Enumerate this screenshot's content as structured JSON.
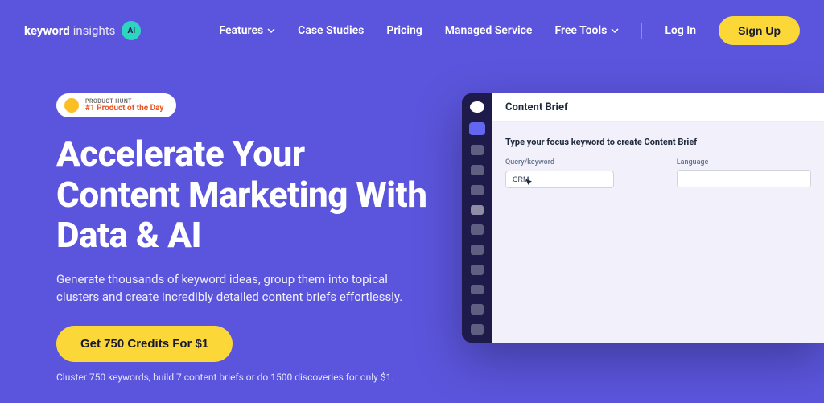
{
  "logo": {
    "part1": "keyword",
    "part2": "insights",
    "badge": "AI"
  },
  "nav": {
    "features": "Features",
    "case_studies": "Case Studies",
    "pricing": "Pricing",
    "managed_service": "Managed Service",
    "free_tools": "Free Tools",
    "login": "Log In",
    "signup": "Sign Up"
  },
  "ph": {
    "top": "PRODUCT HUNT",
    "bottom": "#1 Product of the Day"
  },
  "hero": {
    "headline": "Accelerate Your Content Marketing With Data & AI",
    "subhead": "Generate thousands of keyword ideas, group them into topical clusters and create incredibly detailed content briefs effortlessly.",
    "cta": "Get 750 Credits For $1",
    "cta_sub": "Cluster 750 keywords, build 7 content briefs or do 1500 discoveries for only $1."
  },
  "mockup": {
    "header": "Content Brief",
    "title": "Type your focus keyword to create Content Brief",
    "field1_label": "Query/keyword",
    "field1_value": "CRM",
    "field2_label": "Language"
  }
}
